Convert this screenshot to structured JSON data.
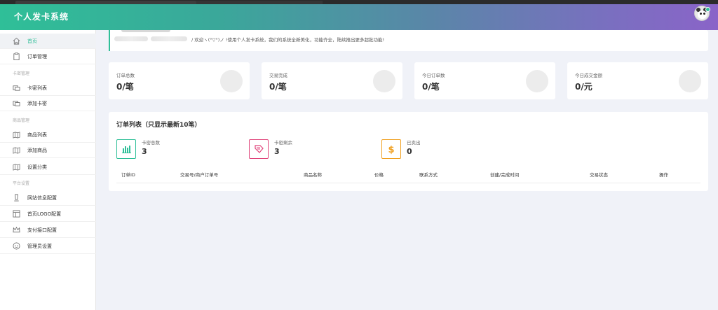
{
  "app": {
    "title": "个人发卡系统"
  },
  "sidebar": {
    "items": [
      {
        "label": "首页",
        "active": true
      },
      {
        "label": "订单管理"
      },
      {
        "group": "卡密管理"
      },
      {
        "label": "卡密列表"
      },
      {
        "label": "添加卡密"
      },
      {
        "group": "商品管理"
      },
      {
        "label": "商品列表"
      },
      {
        "label": "添加商品"
      },
      {
        "label": "设置分类"
      },
      {
        "group": "平台设置"
      },
      {
        "label": "网站信息配置"
      },
      {
        "label": "首页LOGO配置"
      },
      {
        "label": "支付接口配置"
      },
      {
        "label": "管理员设置"
      }
    ]
  },
  "notice": {
    "text": "/ 欢迎ヽ(°▽°)ノ !使用个人发卡系统，我们的系统全新美化，功能齐全，陆续推出更多超批功能!"
  },
  "stats": [
    {
      "label": "订单总数",
      "value": "0/笔"
    },
    {
      "label": "交易完成",
      "value": "0/笔"
    },
    {
      "label": "今日订单数",
      "value": "0/笔"
    },
    {
      "label": "今日成交金额",
      "value": "0/元"
    }
  ],
  "orders": {
    "heading": "订单列表（只显示最新10笔）",
    "mini_stats": [
      {
        "label": "卡密总数",
        "value": "3",
        "icon": "bar-chart-icon",
        "color": "#2fbf98"
      },
      {
        "label": "卡密剩余",
        "value": "3",
        "icon": "tag-icon",
        "color": "#e0457b"
      },
      {
        "label": "已卖出",
        "value": "0",
        "icon": "dollar-icon",
        "color": "#f0a020"
      }
    ],
    "columns": [
      "订单ID",
      "交易号/商户订单号",
      "商品名称",
      "价格",
      "联系方式",
      "创建/完成时间",
      "交易状态",
      "操作"
    ]
  }
}
